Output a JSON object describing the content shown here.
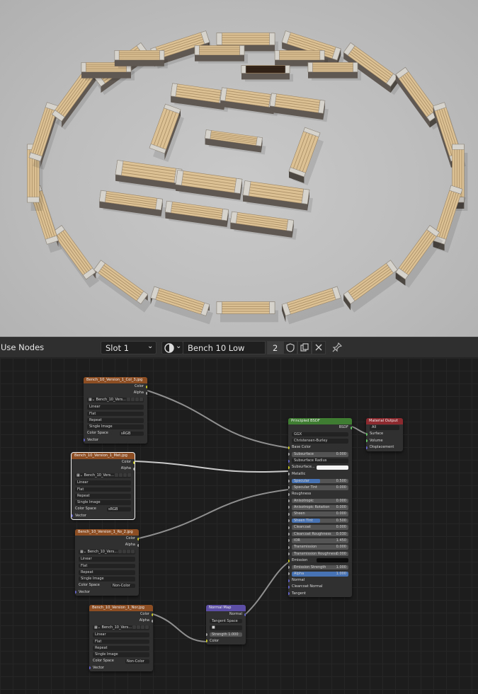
{
  "header": {
    "use_nodes": "Use Nodes",
    "slot": "Slot 1",
    "material_name": "Bench 10 Low",
    "user_count": "2",
    "icons": [
      "sphere-icon",
      "shield-icon",
      "duplicate-icon",
      "close-icon",
      "pin-icon"
    ]
  },
  "colors": {
    "texture_header": "#8d4e24",
    "shader_header": "#3f7d33",
    "output_header": "#8c2a30",
    "vector_header": "#5b4ea4",
    "socket_color": "#c7c729",
    "socket_float": "#a1a1a1",
    "socket_vector": "#6363c7",
    "socket_shader": "#63c763",
    "slider_blue": "#4772b3"
  },
  "nodes": {
    "tex1": {
      "title": "Bench_10_Version_1_Col_3.jpg",
      "out_color": "Color",
      "out_alpha": "Alpha",
      "image": "Bench_10_Vers...",
      "interpolation": "Linear",
      "projection": "Flat",
      "extension": "Repeat",
      "source": "Single Image",
      "color_space_label": "Color Space",
      "color_space": "sRGB",
      "vector": "Vector"
    },
    "tex2": {
      "title": "Bench_10_Version_1_Met.jpg",
      "out_color": "Color",
      "out_alpha": "Alpha",
      "image": "Bench_10_Vers...",
      "interpolation": "Linear",
      "projection": "Flat",
      "extension": "Repeat",
      "source": "Single Image",
      "color_space_label": "Color Space",
      "color_space": "sRGB",
      "vector": "Vector"
    },
    "tex3": {
      "title": "Bench_10_Version_1_Ro_2.jpg",
      "out_color": "Color",
      "out_alpha": "Alpha",
      "image": "Bench_10_Vers...",
      "interpolation": "Linear",
      "projection": "Flat",
      "extension": "Repeat",
      "source": "Single Image",
      "color_space_label": "Color Space",
      "color_space": "Non-Color",
      "vector": "Vector"
    },
    "tex4": {
      "title": "Bench_10_Version_1_Nor.jpg",
      "out_color": "Color",
      "out_alpha": "Alpha",
      "image": "Bench_10_Vers...",
      "interpolation": "Linear",
      "projection": "Flat",
      "extension": "Repeat",
      "source": "Single Image",
      "color_space_label": "Color Space",
      "color_space": "Non-Color",
      "vector": "Vector"
    },
    "normal_map": {
      "title": "Normal Map",
      "out_normal": "Normal",
      "space": "Tangent Space",
      "strength_label": "Strength",
      "strength": "1.000",
      "in_color": "Color"
    },
    "bsdf": {
      "title": "Principled BSDF",
      "out_bsdf": "BSDF",
      "distribution": "GGX",
      "subsurface_method": "Christensen-Burley",
      "base_color": "Base Color",
      "subsurface": "Subsurface",
      "subsurface_val": "0.000",
      "subsurface_radius": "Subsurface Radius",
      "subsurface_color": "Subsurface...",
      "metallic": "Metallic",
      "specular": "Specular",
      "specular_val": "0.500",
      "specular_fill": 0.5,
      "specular_tint": "Specular Tint",
      "specular_tint_val": "0.000",
      "roughness": "Roughness",
      "anisotropic": "Anisotropic",
      "anisotropic_val": "0.000",
      "aniso_rotation": "Anisotropic Rotation",
      "aniso_rotation_val": "0.000",
      "sheen": "Sheen",
      "sheen_val": "0.000",
      "sheen_tint": "Sheen Tint",
      "sheen_tint_val": "0.500",
      "sheen_tint_fill": 0.5,
      "clearcoat": "Clearcoat",
      "clearcoat_val": "0.000",
      "clearcoat_rough": "Clearcoat Roughness",
      "clearcoat_rough_val": "0.030",
      "ior": "IOR",
      "ior_val": "1.450",
      "transmission": "Transmission",
      "transmission_val": "0.000",
      "transmission_rough": "Transmission Roughness",
      "transmission_rough_val": "0.000",
      "emission": "Emission",
      "emission_strength": "Emission Strength",
      "emission_strength_val": "1.000",
      "alpha": "Alpha",
      "alpha_val": "1.000",
      "alpha_fill": 1.0,
      "normal": "Normal",
      "clearcoat_normal": "Clearcoat Normal",
      "tangent": "Tangent"
    },
    "output": {
      "title": "Material Output",
      "target": "All",
      "surface": "Surface",
      "volume": "Volume",
      "displacement": "Displacement"
    }
  }
}
